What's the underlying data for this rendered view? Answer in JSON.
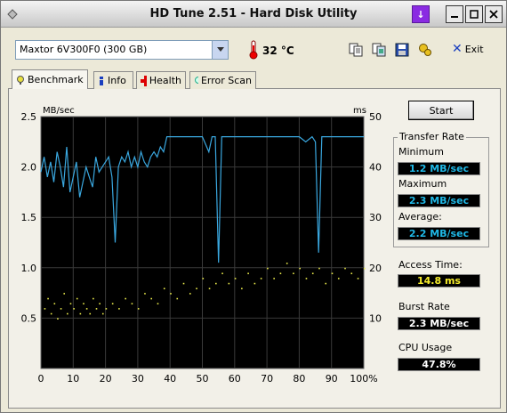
{
  "window": {
    "title": "HD Tune 2.51 - Hard Disk Utility"
  },
  "toolbar": {
    "drive": "Maxtor 6V300F0 (300 GB)",
    "temperature": "32 °C",
    "exit_label": "Exit"
  },
  "tabs": [
    {
      "label": "Benchmark"
    },
    {
      "label": "Info"
    },
    {
      "label": "Health"
    },
    {
      "label": "Error Scan"
    }
  ],
  "panel": {
    "start_label": "Start",
    "transfer_rate_title": "Transfer Rate",
    "minimum_label": "Minimum",
    "minimum_value": "1.2 MB/sec",
    "maximum_label": "Maximum",
    "maximum_value": "2.3 MB/sec",
    "average_label": "Average:",
    "average_value": "2.2 MB/sec",
    "access_label": "Access Time:",
    "access_value": "14.8 ms",
    "burst_label": "Burst Rate",
    "burst_value": "2.3 MB/sec",
    "cpu_label": "CPU Usage",
    "cpu_value": "47.8%"
  },
  "colors": {
    "transfer_line": "#3aa8e0",
    "access_points": "#e8e84a",
    "chart_bg": "#000000",
    "grid": "#3a3a3a"
  },
  "chart_data": {
    "type": "line",
    "left_axis_label": "MB/sec",
    "right_axis_label": "ms",
    "ylim_left": [
      0,
      2.5
    ],
    "ylim_right": [
      0,
      50
    ],
    "xlim": [
      0,
      100
    ],
    "y_ticks_left": [
      "0.5",
      "1.0",
      "1.5",
      "2.0",
      "2.5"
    ],
    "y_ticks_right": [
      "10",
      "20",
      "30",
      "40",
      "50"
    ],
    "x_ticks": [
      "0",
      "10",
      "20",
      "30",
      "40",
      "50",
      "60",
      "70",
      "80",
      "90",
      "100%"
    ],
    "grid": true,
    "series": [
      {
        "name": "Transfer Rate",
        "axis": "left",
        "x": [
          0,
          1,
          2,
          3,
          4,
          5,
          6,
          7,
          8,
          9,
          10,
          11,
          12,
          13,
          14,
          15,
          16,
          17,
          18,
          19,
          20,
          21,
          22,
          23,
          24,
          25,
          26,
          27,
          28,
          29,
          30,
          31,
          32,
          33,
          34,
          35,
          36,
          37,
          38,
          39,
          40,
          42,
          44,
          46,
          48,
          50,
          52,
          53,
          54,
          55,
          56,
          58,
          60,
          62,
          64,
          66,
          68,
          70,
          72,
          74,
          76,
          78,
          80,
          82,
          84,
          85,
          86,
          87,
          88,
          90,
          92,
          94,
          96,
          98,
          100
        ],
        "y": [
          1.95,
          2.1,
          1.9,
          2.05,
          1.85,
          2.15,
          2.0,
          1.8,
          2.2,
          1.75,
          1.9,
          2.05,
          1.7,
          1.85,
          2.0,
          1.9,
          1.8,
          2.1,
          1.95,
          2.0,
          2.05,
          2.1,
          1.9,
          1.25,
          2.0,
          2.1,
          2.05,
          2.15,
          2.0,
          2.1,
          2.0,
          2.15,
          2.05,
          2.0,
          2.1,
          2.15,
          2.1,
          2.2,
          2.15,
          2.3,
          2.3,
          2.3,
          2.3,
          2.3,
          2.3,
          2.3,
          2.15,
          2.3,
          2.3,
          1.05,
          2.3,
          2.3,
          2.3,
          2.3,
          2.3,
          2.3,
          2.3,
          2.3,
          2.3,
          2.3,
          2.3,
          2.3,
          2.3,
          2.25,
          2.3,
          2.25,
          1.15,
          2.3,
          2.3,
          2.3,
          2.3,
          2.3,
          2.3,
          2.3,
          2.3
        ]
      },
      {
        "name": "Access Time",
        "axis": "right",
        "kind": "scatter",
        "x": [
          1,
          2,
          3,
          4,
          5,
          6,
          7,
          8,
          9,
          10,
          11,
          12,
          13,
          14,
          15,
          16,
          17,
          18,
          19,
          20,
          22,
          24,
          26,
          28,
          30,
          32,
          34,
          36,
          38,
          40,
          42,
          44,
          46,
          48,
          50,
          52,
          54,
          56,
          58,
          60,
          62,
          64,
          66,
          68,
          70,
          72,
          74,
          76,
          78,
          80,
          82,
          84,
          86,
          88,
          90,
          92,
          94,
          96,
          98,
          100
        ],
        "y": [
          12,
          14,
          11,
          13,
          10,
          12,
          15,
          11,
          13,
          12,
          14,
          11,
          13,
          12,
          11,
          14,
          12,
          13,
          11,
          12,
          13,
          12,
          14,
          13,
          12,
          15,
          14,
          13,
          16,
          15,
          14,
          17,
          15,
          16,
          18,
          16,
          17,
          19,
          17,
          18,
          16,
          19,
          17,
          18,
          20,
          18,
          19,
          21,
          19,
          20,
          18,
          19,
          20,
          17,
          19,
          18,
          20,
          19,
          18,
          20
        ]
      }
    ]
  }
}
